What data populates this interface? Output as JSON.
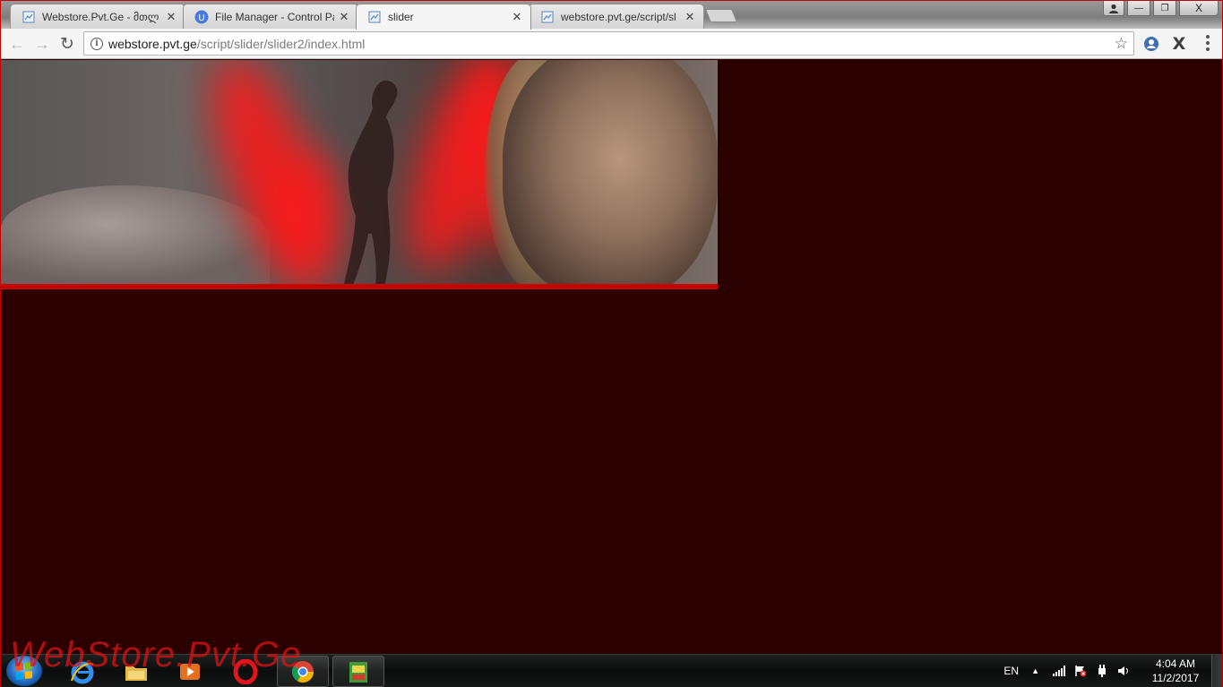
{
  "browser": {
    "tabs": [
      {
        "title": "Webstore.Pvt.Ge - მთლ",
        "icon": "page-favicon",
        "active": false
      },
      {
        "title": "File Manager - Control Pa",
        "icon": "u-favicon",
        "active": false
      },
      {
        "title": "slider",
        "icon": "page-favicon",
        "active": true
      },
      {
        "title": "webstore.pvt.ge/script/sl",
        "icon": "page-favicon",
        "active": false
      }
    ],
    "window_controls": {
      "minimize": "—",
      "maximize": "❐",
      "close": "X"
    },
    "address_bar": {
      "host": "webstore.pvt.ge",
      "path": "/script/slider/slider2/index.html"
    }
  },
  "page": {
    "background_color": "#2a0000",
    "accent_color": "#c80000",
    "banner": "slider-image"
  },
  "taskbar": {
    "watermark": "WebStore.Pvt.Ge",
    "pinned": [
      "internet-explorer",
      "file-explorer",
      "media-player",
      "opera",
      "chrome",
      "app"
    ],
    "tray": {
      "language": "EN",
      "time": "4:04 AM",
      "date": "11/2/2017"
    }
  }
}
